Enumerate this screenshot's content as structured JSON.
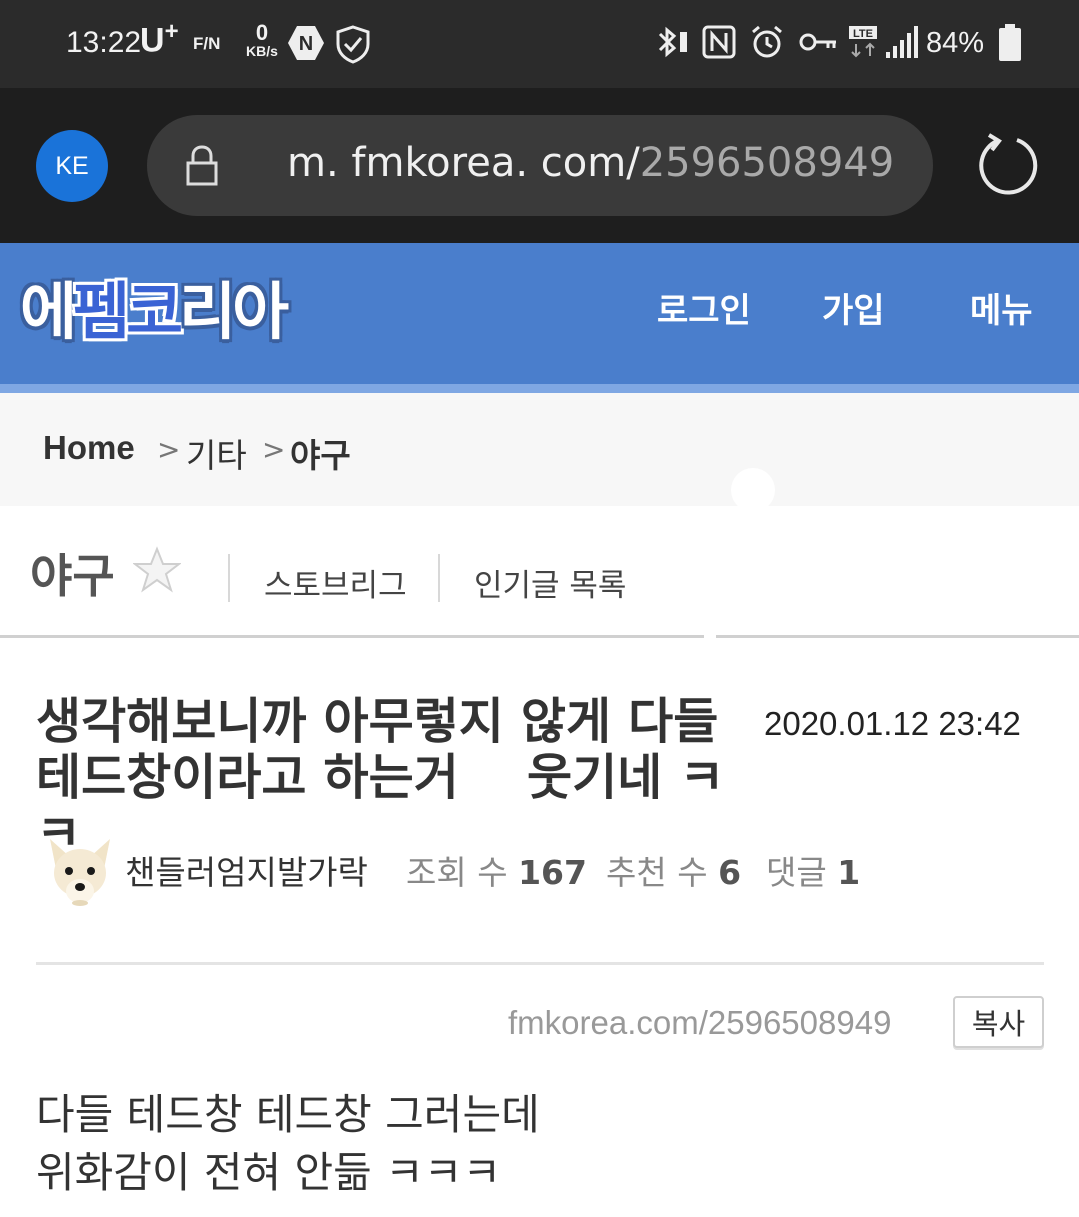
{
  "status_bar": {
    "time": "13:22",
    "carrier": "U",
    "carrier_sup": "+",
    "carrier_sub": "F/N",
    "net_speed_value": "0",
    "net_speed_unit": "KB/s",
    "battery_percent": "84%",
    "icons": [
      "naver-n-icon",
      "shield-check-icon",
      "bluetooth-icon",
      "nfc-icon",
      "alarm-icon",
      "key-icon",
      "lte-icon",
      "signal-icon",
      "battery-icon"
    ]
  },
  "browser": {
    "profile_initials": "KE",
    "url_host": "m. fmkorea. com/",
    "url_path": "2596508949"
  },
  "site_header": {
    "logo_part1": "에",
    "logo_part2": "펨코",
    "logo_part3": "리아",
    "login": "로그인",
    "join": "가입",
    "menu": "메뉴"
  },
  "breadcrumb": {
    "home": "Home",
    "category": "기타",
    "current": "야구",
    "separator": ">"
  },
  "board": {
    "title": "야구",
    "links": [
      "스토브리그",
      "인기글 목록"
    ]
  },
  "post": {
    "title": "생각해보니까 아무렇지 않게 다들\n테드창이라고 하는거    웃기네 ㅋㅋ",
    "date": "2020.01.12 23:42",
    "author": "챈들러엄지발가락",
    "views_label": "조회 수",
    "views": "167",
    "recommend_label": "추천 수",
    "recommend": "6",
    "comments_label": "댓글",
    "comments": "1",
    "short_link": "fmkorea.com/2596508949",
    "copy_label": "복사",
    "body_lines": [
      "다들 테드창 테드창 그러는데",
      "위화감이 전혀 안듦 ㅋㅋㅋ"
    ]
  },
  "colors": {
    "header_blue": "#4a7ecc",
    "header_line": "#7fa7e3",
    "profile_blue": "#1a73d9"
  }
}
